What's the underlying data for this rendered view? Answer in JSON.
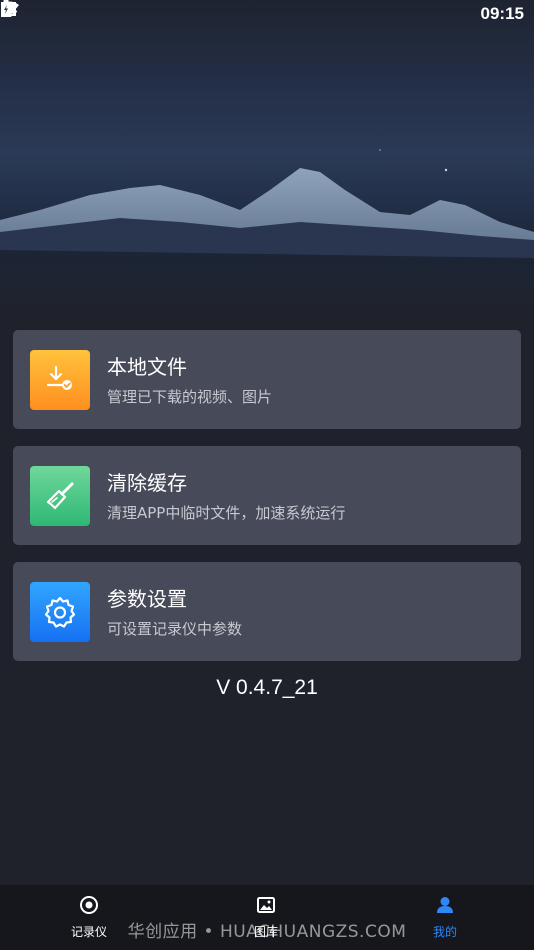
{
  "status_bar": {
    "time": "09:15",
    "left_icons": [
      "sync-icon",
      "sync-icon",
      "font-icon"
    ],
    "right_icons": [
      "wifi-icon",
      "airplane-icon",
      "battery-icon"
    ]
  },
  "menu": [
    {
      "title": "本地文件",
      "subtitle": "管理已下载的视频、图片",
      "icon": "download-icon",
      "color_start": "#ffc23c",
      "color_end": "#ff8f1f"
    },
    {
      "title": "清除缓存",
      "subtitle": "清理APP中临时文件，加速系统运行",
      "icon": "brush-icon",
      "color_start": "#6fd89a",
      "color_end": "#2fb774"
    },
    {
      "title": "参数设置",
      "subtitle": "可设置记录仪中参数",
      "icon": "gear-icon",
      "color_start": "#31a6ff",
      "color_end": "#1670f2"
    }
  ],
  "version": "V 0.4.7_21",
  "bottom_nav": {
    "items": [
      {
        "label": "记录仪",
        "icon": "recorder-icon",
        "active": false
      },
      {
        "label": "图库",
        "icon": "gallery-icon",
        "active": false
      },
      {
        "label": "我的",
        "icon": "person-icon",
        "active": true
      }
    ],
    "active_color": "#2f86f6"
  },
  "watermark": "华创应用 • HUACHUANGZS.COM"
}
